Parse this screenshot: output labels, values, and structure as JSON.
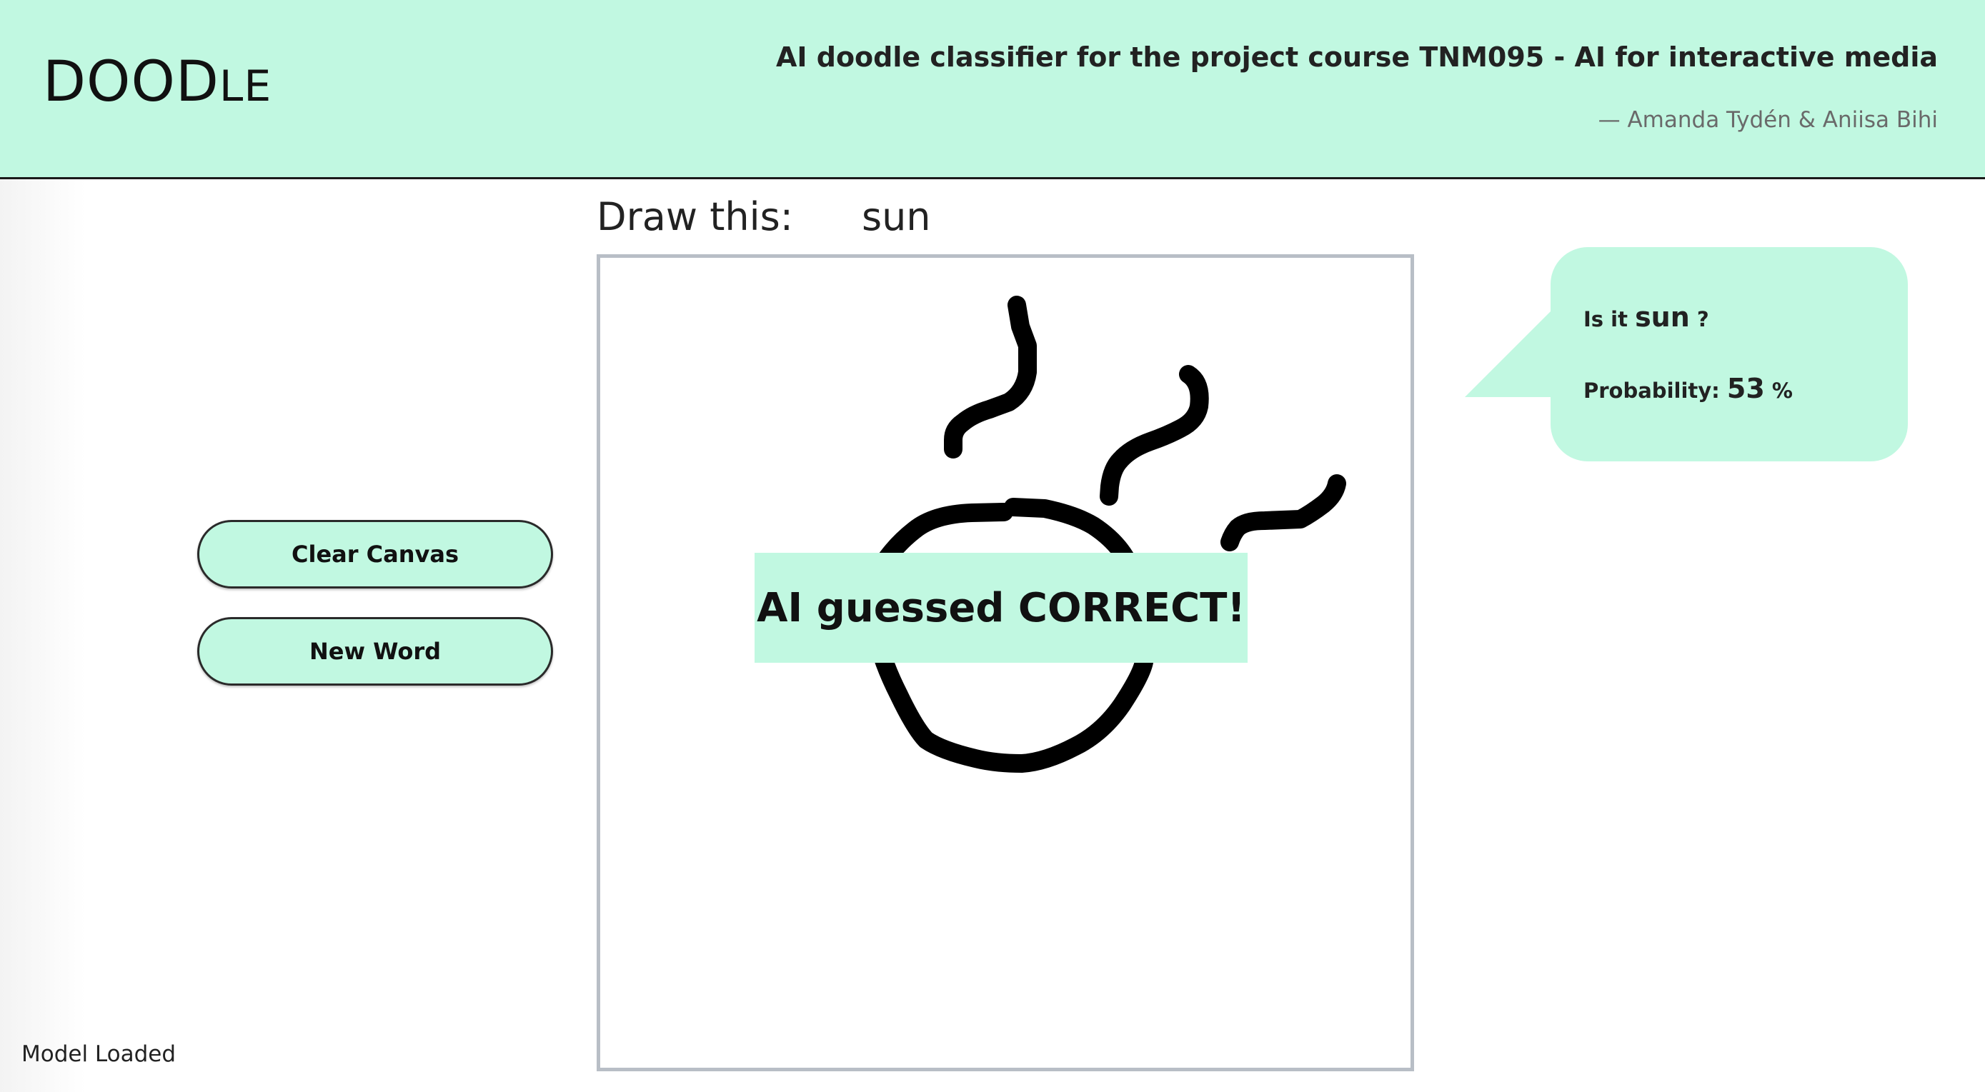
{
  "header": {
    "logo_main": "DOOD",
    "logo_small": "LE",
    "title": "AI doodle classifier for the project course TNM095 - AI for interactive media",
    "authors": "— Amanda Tydén & Aniisa Bihi",
    "background_color": "#c1f8e1"
  },
  "prompt": {
    "label": "Draw this:",
    "word": "sun"
  },
  "canvas": {
    "result_text": "AI guessed CORRECT!",
    "stroke_color": "#000000"
  },
  "controls": {
    "clear_label": "Clear Canvas",
    "new_word_label": "New Word"
  },
  "prediction": {
    "prefix": "Is it",
    "guess": "sun",
    "suffix": "?",
    "probability_label": "Probability:",
    "probability_value": "53",
    "probability_unit": "%"
  },
  "status": {
    "text": "Model Loaded"
  }
}
